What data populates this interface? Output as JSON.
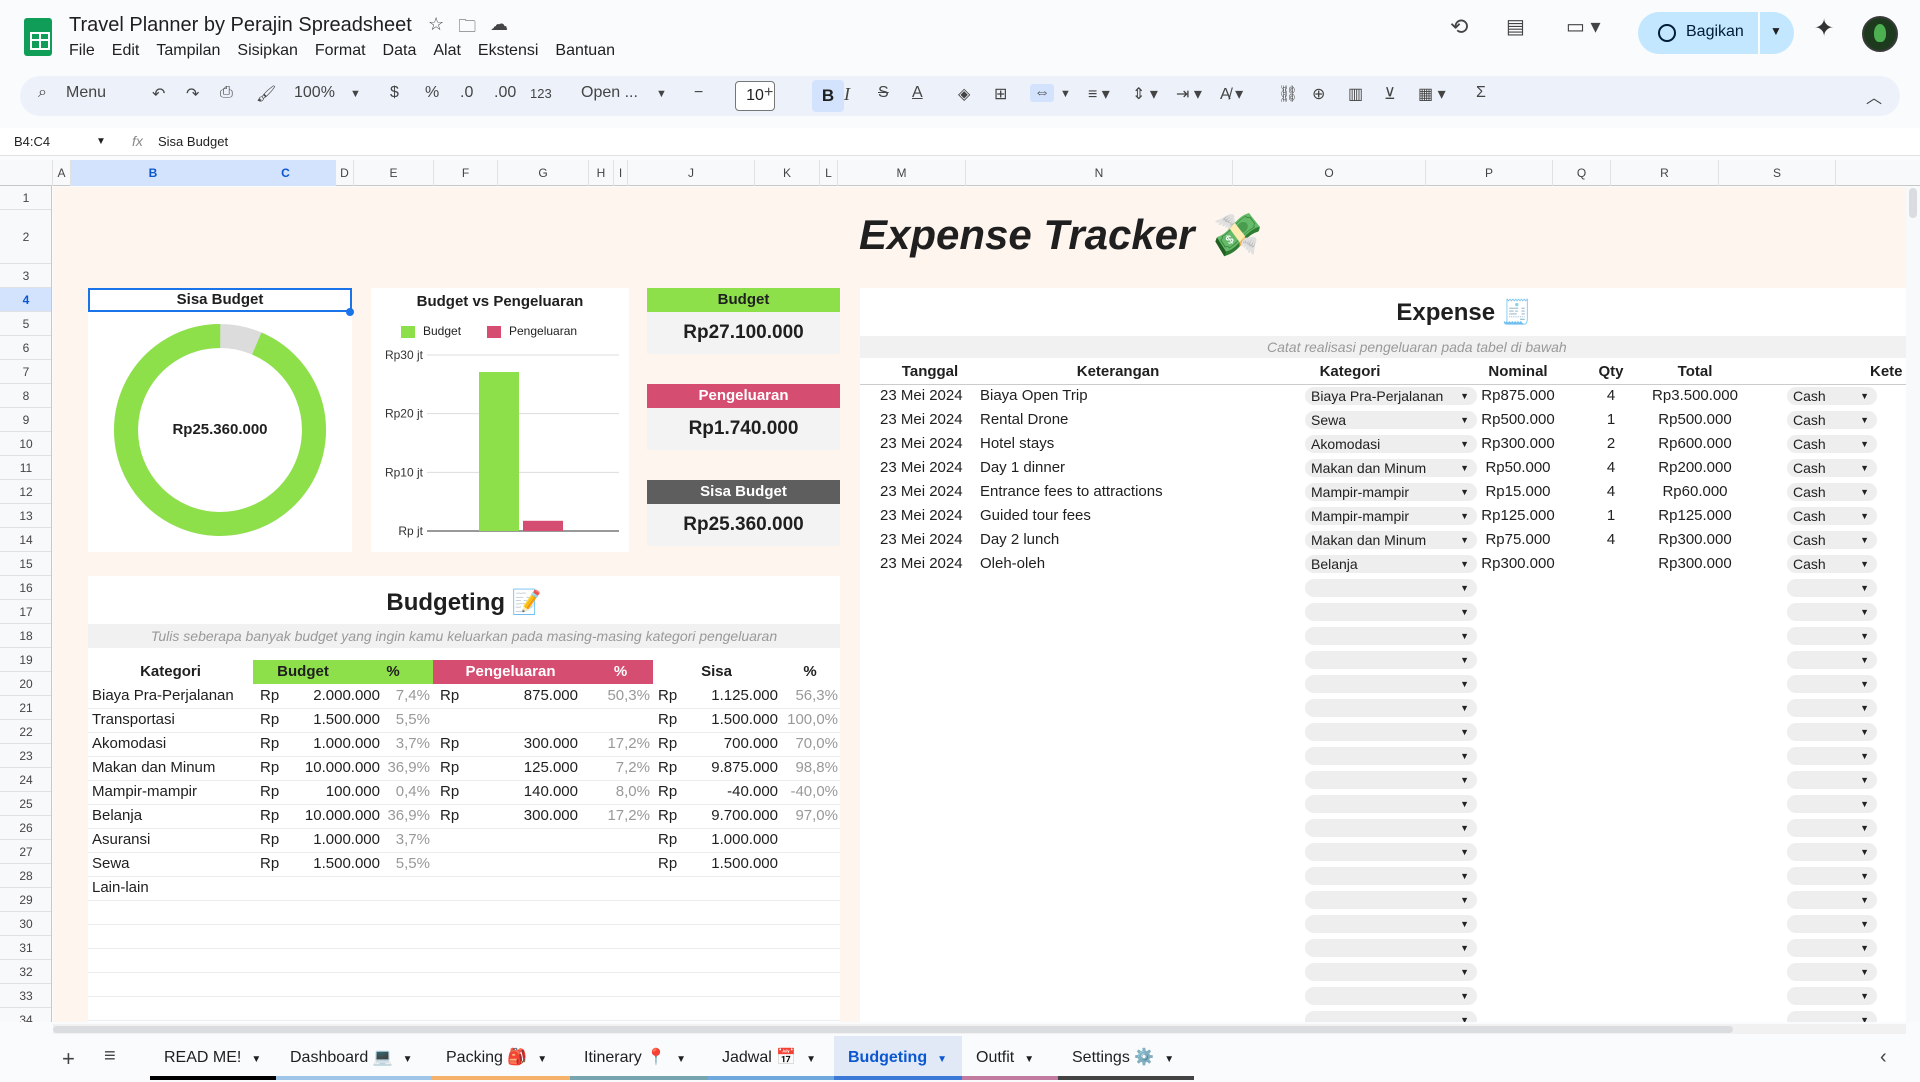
{
  "titlebar": {
    "doc_title": "Travel Planner by Perajin Spreadsheet",
    "menu": [
      "File",
      "Edit",
      "Tampilan",
      "Sisipkan",
      "Format",
      "Data",
      "Alat",
      "Ekstensi",
      "Bantuan"
    ],
    "share_label": "Bagikan"
  },
  "toolbar": {
    "menu_label": "Menu",
    "zoom": "100%",
    "currency": "$",
    "percent": "%",
    "dec_down": ".0",
    "dec_up": ".00",
    "number_format": "123",
    "font": "Open ...",
    "font_size": "10",
    "bold": "B",
    "italic": "I",
    "strike": "S",
    "text_color": "A",
    "sum": "Σ"
  },
  "formula": {
    "cell_ref": "B4:C4",
    "fx": "fx",
    "content": "Sisa Budget"
  },
  "columns": [
    "A",
    "B",
    "C",
    "D",
    "E",
    "F",
    "G",
    "H",
    "I",
    "J",
    "K",
    "L",
    "M",
    "N",
    "O",
    "P",
    "Q",
    "R",
    "S"
  ],
  "rows": [
    "1",
    "2",
    "3",
    "4",
    "5",
    "6",
    "7",
    "8",
    "9",
    "10",
    "11",
    "12",
    "13",
    "14",
    "15",
    "16",
    "17",
    "18",
    "19",
    "20",
    "21",
    "22",
    "23",
    "24",
    "25",
    "26",
    "27",
    "28",
    "29",
    "30",
    "31",
    "32",
    "33",
    "34"
  ],
  "sheet": {
    "title": "Expense Tracker 💸",
    "donut": {
      "title": "Sisa Budget",
      "center": "Rp25.360.000",
      "remaining_fraction": 0.936
    },
    "bar_chart": {
      "title": "Budget vs Pengeluaran",
      "legend": [
        "Budget",
        "Pengeluaran"
      ],
      "ticks": [
        "Rp30 jt",
        "Rp20 jt",
        "Rp10 jt",
        "Rp jt"
      ],
      "budget_value": 27100000,
      "expense_value": 1740000,
      "ymax": 30000000
    },
    "kpi": {
      "budget_label": "Budget",
      "budget_value": "Rp27.100.000",
      "expense_label": "Pengeluaran",
      "expense_value": "Rp1.740.000",
      "remaining_label": "Sisa Budget",
      "remaining_value": "Rp25.360.000"
    },
    "budgeting": {
      "title": "Budgeting 📝",
      "note": "Tulis seberapa banyak budget yang ingin kamu keluarkan pada masing-masing kategori pengeluaran",
      "headers": [
        "Kategori",
        "Budget",
        "%",
        "Pengeluaran",
        "%",
        "Sisa",
        "%"
      ],
      "rows": [
        [
          "Biaya Pra-Perjalanan",
          "Rp",
          "2.000.000",
          "7,4%",
          "Rp",
          "875.000",
          "50,3%",
          "Rp",
          "1.125.000",
          "56,3%"
        ],
        [
          "Transportasi",
          "Rp",
          "1.500.000",
          "5,5%",
          "",
          "",
          "",
          "Rp",
          "1.500.000",
          "100,0%"
        ],
        [
          "Akomodasi",
          "Rp",
          "1.000.000",
          "3,7%",
          "Rp",
          "300.000",
          "17,2%",
          "Rp",
          "700.000",
          "70,0%"
        ],
        [
          "Makan dan Minum",
          "Rp",
          "10.000.000",
          "36,9%",
          "Rp",
          "125.000",
          "7,2%",
          "Rp",
          "9.875.000",
          "98,8%"
        ],
        [
          "Mampir-mampir",
          "Rp",
          "100.000",
          "0,4%",
          "Rp",
          "140.000",
          "8,0%",
          "Rp",
          "-40.000",
          "-40,0%"
        ],
        [
          "Belanja",
          "Rp",
          "10.000.000",
          "36,9%",
          "Rp",
          "300.000",
          "17,2%",
          "Rp",
          "9.700.000",
          "97,0%"
        ],
        [
          "Asuransi",
          "Rp",
          "1.000.000",
          "3,7%",
          "",
          "",
          "",
          "Rp",
          "1.000.000",
          ""
        ],
        [
          "Sewa",
          "Rp",
          "1.500.000",
          "5,5%",
          "",
          "",
          "",
          "Rp",
          "1.500.000",
          ""
        ],
        [
          "Lain-lain",
          "",
          "",
          "",
          "",
          "",
          "",
          "",
          "",
          ""
        ]
      ]
    },
    "expense": {
      "title": "Expense 🧾",
      "note": "Catat realisasi pengeluaran pada tabel di bawah",
      "headers": [
        "Tanggal",
        "Keterangan",
        "Kategori",
        "Nominal",
        "Qty",
        "Total",
        "",
        "Kete"
      ],
      "rows": [
        [
          "23 Mei 2024",
          "Biaya Open Trip",
          "Biaya Pra-Perjalanan",
          "Rp875.000",
          "4",
          "Rp3.500.000",
          "Cash"
        ],
        [
          "23 Mei 2024",
          "Rental Drone",
          "Sewa",
          "Rp500.000",
          "1",
          "Rp500.000",
          "Cash"
        ],
        [
          "23 Mei 2024",
          "Hotel stays",
          "Akomodasi",
          "Rp300.000",
          "2",
          "Rp600.000",
          "Cash"
        ],
        [
          "23 Mei 2024",
          "Day 1 dinner",
          "Makan dan Minum",
          "Rp50.000",
          "4",
          "Rp200.000",
          "Cash"
        ],
        [
          "23 Mei 2024",
          "Entrance fees to attractions",
          "Mampir-mampir",
          "Rp15.000",
          "4",
          "Rp60.000",
          "Cash"
        ],
        [
          "23 Mei 2024",
          "Guided tour fees",
          "Mampir-mampir",
          "Rp125.000",
          "1",
          "Rp125.000",
          "Cash"
        ],
        [
          "23 Mei 2024",
          "Day 2 lunch",
          "Makan dan Minum",
          "Rp75.000",
          "4",
          "Rp300.000",
          "Cash"
        ],
        [
          "23 Mei 2024",
          "Oleh-oleh",
          "Belanja",
          "Rp300.000",
          "",
          "Rp300.000",
          "Cash"
        ]
      ]
    }
  },
  "tabs": [
    {
      "label": "READ ME!",
      "color": "#000000"
    },
    {
      "label": "Dashboard 💻",
      "color": "#9fc5e8"
    },
    {
      "label": "Packing 🎒",
      "color": "#f6b26b"
    },
    {
      "label": "Itinerary 📍",
      "color": "#76a5af"
    },
    {
      "label": "Jadwal 📅",
      "color": "#6fa8dc"
    },
    {
      "label": "Budgeting",
      "color": "#3c78d8"
    },
    {
      "label": "Outfit",
      "color": "#c27ba0"
    },
    {
      "label": "Settings ⚙️",
      "color": "#434343"
    }
  ],
  "colors": {
    "budget": "#8ee04b",
    "expense": "#d64d72",
    "remaining": "#5e5e5e",
    "sheet_bg": "#fef5ef"
  }
}
